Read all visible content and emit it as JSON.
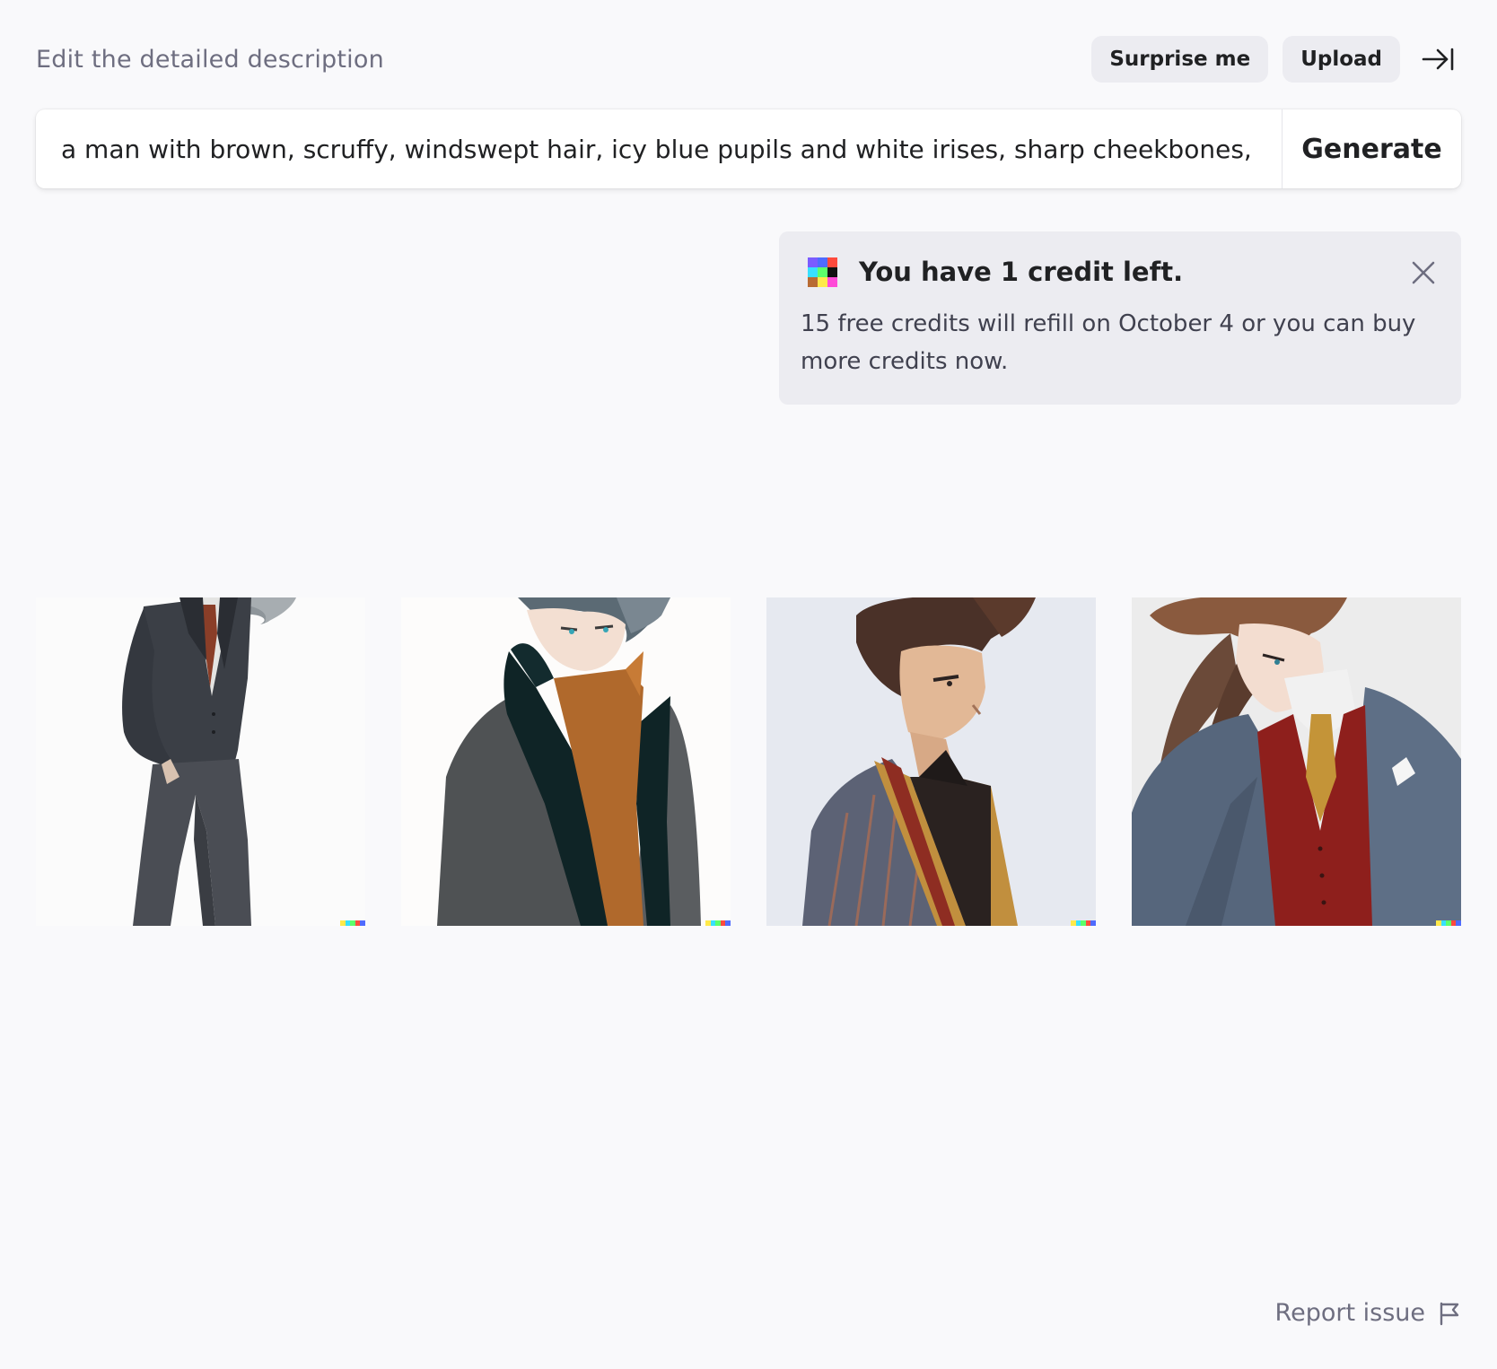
{
  "header": {
    "label": "Edit the detailed description",
    "surprise_label": "Surprise me",
    "upload_label": "Upload",
    "collapse_icon": "arrow-right-to-bar-icon"
  },
  "prompt": {
    "text": "a man with brown, scruffy, windswept hair, icy blue pupils and white irises, sharp cheekbones, we",
    "generate_label": "Generate"
  },
  "notice": {
    "title": "You have 1 credit left.",
    "body": "15 free credits will refill on October 4 or you can buy more credits now.",
    "logo_icon": "color-grid-logo-icon",
    "close_icon": "close-icon",
    "logo_colors": [
      "#7b5cff",
      "#4f6bff",
      "#ff4a3d",
      "#37e0ff",
      "#5cff6b",
      "#111111",
      "#b86b33",
      "#ffe94a",
      "#ff4ad8"
    ]
  },
  "images": [
    {
      "subject": "man in dark grey three-piece suit with silver hair"
    },
    {
      "subject": "man with grey spiky hair in textured coat"
    },
    {
      "subject": "man with brown swept hair in striped jacket"
    },
    {
      "subject": "man with windswept brown hair in blue suit and red vest"
    }
  ],
  "footer": {
    "report_label": "Report issue",
    "report_icon": "flag-icon"
  },
  "colors": {
    "background": "#f9f9fb",
    "pill": "#ececf1",
    "text": "#202123",
    "muted": "#6e6e80"
  }
}
